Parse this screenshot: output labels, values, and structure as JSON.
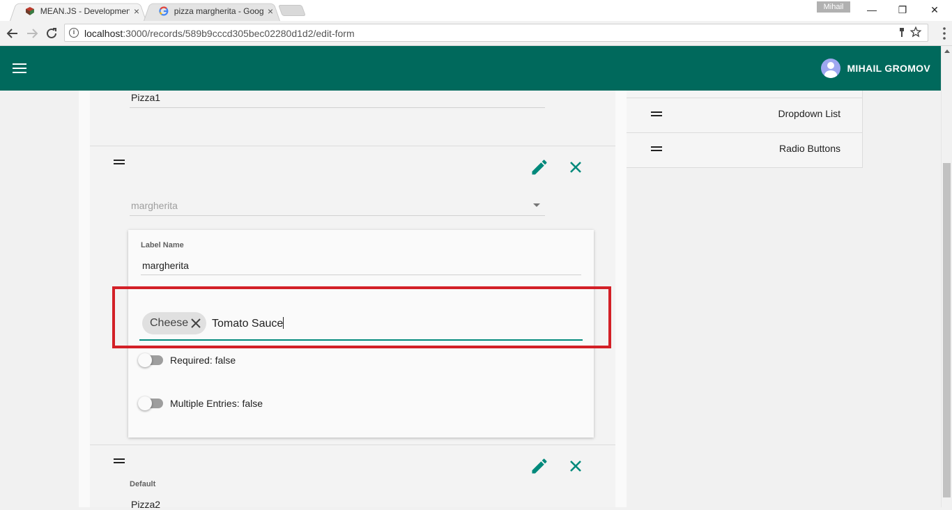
{
  "browser": {
    "tabs": [
      {
        "title": "MEAN.JS - Development",
        "close": "×"
      },
      {
        "title": "pizza margherita - Googl",
        "close": "×"
      }
    ],
    "profile": "Mihail",
    "controls": {
      "minimize": "—",
      "restore": "❐",
      "close": "✕"
    },
    "url_host": "localhost",
    "url_path": ":3000/records/589b9cccd305bec02280d1d2/edit-form"
  },
  "appbar": {
    "user_name": "MIHAIL GROMOV"
  },
  "form": {
    "field1_value": "Pizza1",
    "select_value": "margherita",
    "editor": {
      "label_caption": "Label Name",
      "label_value": "margherita",
      "chips": [
        "Cheese"
      ],
      "chip_input_value": "Tomato Sauce",
      "required_label": "Required: false",
      "required_on": false,
      "multiple_label": "Multiple Entries: false",
      "multiple_on": false
    },
    "next_field": {
      "caption": "Default",
      "value": "Pizza2"
    }
  },
  "palette": {
    "items": [
      "Dropdown List",
      "Radio Buttons"
    ]
  },
  "colors": {
    "appbar": "#00695c",
    "accent": "#00897b",
    "highlight": "#d32027"
  }
}
